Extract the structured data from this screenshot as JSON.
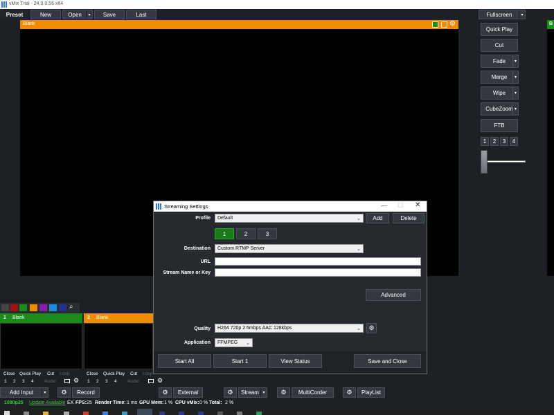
{
  "window": {
    "title": "vMix Trial - 24.0.0.56 x64"
  },
  "toolbar": {
    "preset_label": "Preset",
    "new_label": "New",
    "open_label": "Open",
    "save_label": "Save",
    "last_label": "Last",
    "fullscreen_label": "Fullscreen"
  },
  "preview": {
    "title": "Blank"
  },
  "right_panel": {
    "partial_label": "B"
  },
  "transitions": {
    "quick_play": "Quick Play",
    "cut": "Cut",
    "fade": "Fade",
    "merge": "Merge",
    "wipe": "Wipe",
    "cubezoom": "CubeZoom",
    "ftb": "FTB",
    "numbers": [
      "1",
      "2",
      "3",
      "4"
    ]
  },
  "inputs": [
    {
      "number": "1",
      "name": "Blank",
      "color": "#1a8c1a"
    },
    {
      "number": "2",
      "name": "Blank",
      "color": "#f08c00"
    }
  ],
  "input_controls": {
    "close": "Close",
    "quick_play": "Quick Play",
    "cut": "Cut",
    "loop": "Loop",
    "audio": "Audio",
    "numbers": [
      "1",
      "2",
      "3",
      "4"
    ]
  },
  "bottom_bar": {
    "add_input": "Add Input",
    "record": "Record",
    "external": "External",
    "stream": "Stream",
    "multicorder": "MultiCorder",
    "playlist": "PlayList"
  },
  "status_bar": {
    "resolution": "1080p25",
    "update": "Update Available",
    "ex": "EX",
    "fps_label": "FPS:",
    "fps_value": "25",
    "render_label": "Render Time:",
    "render_value": "1 ms",
    "gpu_label": "GPU Mem:",
    "gpu_value": "1 %",
    "cpu_label": "CPU vMix:",
    "cpu_value": "0 %",
    "total_label": "Total:",
    "total_value": "2 %"
  },
  "dialog": {
    "title": "Streaming Settings",
    "profile_label": "Profile",
    "profile_value": "Default",
    "add_label": "Add",
    "delete_label": "Delete",
    "tabs": [
      "1",
      "2",
      "3"
    ],
    "destination_label": "Destination",
    "destination_value": "Custom RTMP Server",
    "url_label": "URL",
    "url_value": "",
    "stream_key_label": "Stream Name or Key",
    "stream_key_value": "",
    "advanced_label": "Advanced",
    "quality_label": "Quality",
    "quality_value": "H264 720p 2.5mbps AAC 128kbps",
    "application_label": "Application",
    "application_value": "FFMPEG",
    "start_all": "Start All",
    "start_1": "Start 1",
    "view_status": "View Status",
    "save_close": "Save and Close"
  },
  "colors": {
    "accent": "#f08c00",
    "green": "#1a8c1a",
    "background": "#1d2024",
    "update_link": "#33cc33",
    "resolution": "#33cc33"
  }
}
